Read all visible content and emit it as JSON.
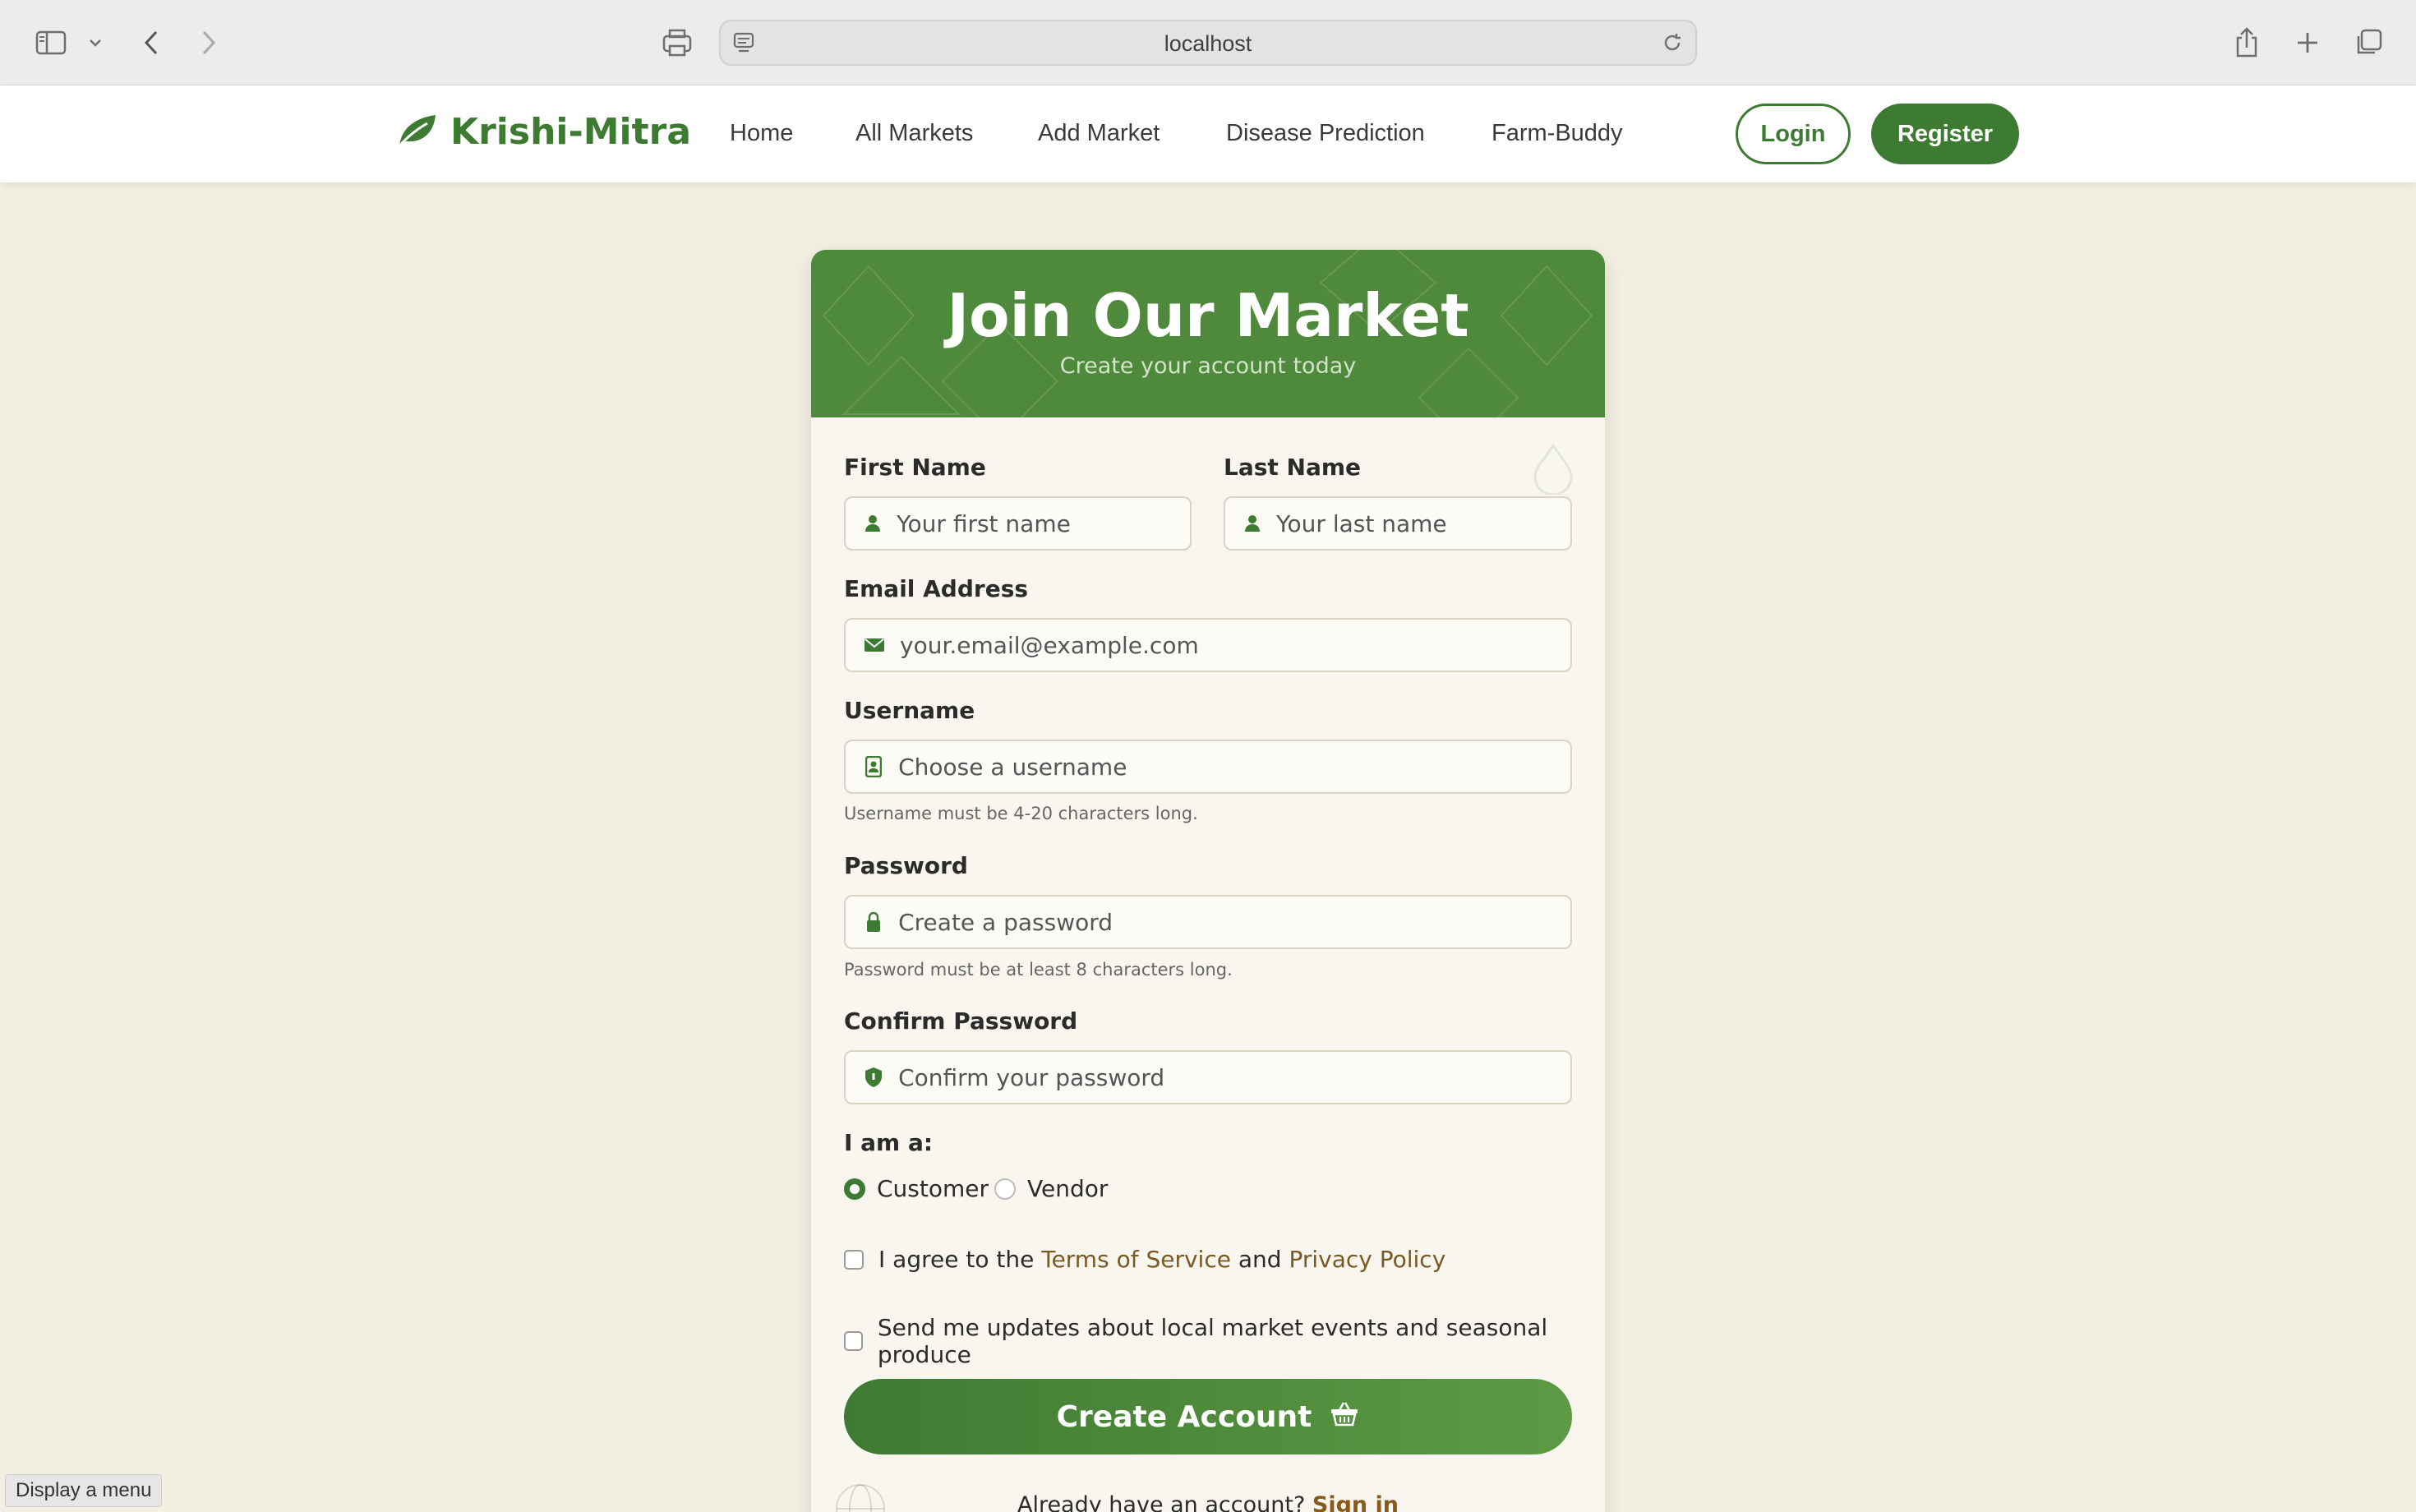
{
  "browser": {
    "url": "localhost",
    "status_text": "Display a menu"
  },
  "nav": {
    "brand": "Krishi-Mitra",
    "links": [
      "Home",
      "All Markets",
      "Add Market",
      "Disease Prediction",
      "Farm-Buddy"
    ],
    "login": "Login",
    "register": "Register"
  },
  "form": {
    "title": "Join Our Market",
    "subtitle": "Create your account today",
    "first_name": {
      "label": "First Name",
      "placeholder": "Your first name"
    },
    "last_name": {
      "label": "Last Name",
      "placeholder": "Your last name"
    },
    "email": {
      "label": "Email Address",
      "placeholder": "your.email@example.com"
    },
    "username": {
      "label": "Username",
      "placeholder": "Choose a username",
      "hint": "Username must be 4-20 characters long."
    },
    "password": {
      "label": "Password",
      "placeholder": "Create a password",
      "hint": "Password must be at least 8 characters long."
    },
    "confirm_password": {
      "label": "Confirm Password",
      "placeholder": "Confirm your password"
    },
    "role": {
      "label": "I am a:",
      "options": [
        "Customer",
        "Vendor"
      ],
      "selected": "Customer"
    },
    "terms": {
      "prefix": "I agree to the",
      "tos": "Terms of Service",
      "and": "and",
      "privacy": "Privacy Policy"
    },
    "updates": "Send me updates about local market events and seasonal produce",
    "submit": "Create Account",
    "signin_prompt": "Already have an account?",
    "signin_link": "Sign in"
  },
  "colors": {
    "brand_green": "#3e7b32",
    "header_green": "#4f8a3c",
    "page_bg": "#f3f0e3",
    "link_brown": "#7a5a24"
  },
  "icons": [
    "sidebar-icon",
    "chevron-down-icon",
    "back-icon",
    "forward-icon",
    "print-icon",
    "site-icon",
    "reload-icon",
    "share-icon",
    "new-tab-icon",
    "tabs-icon",
    "leaf-icon",
    "user-icon",
    "envelope-icon",
    "id-badge-icon",
    "lock-icon",
    "shield-icon",
    "basket-icon",
    "globe-icon",
    "droplet-icon"
  ]
}
